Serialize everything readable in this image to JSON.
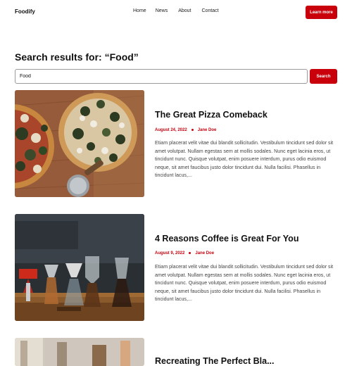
{
  "header": {
    "logo": "Foodify",
    "nav": [
      "Home",
      "News",
      "About",
      "Contact"
    ],
    "cta_label": "Learn more"
  },
  "search": {
    "title": "Search results for: “Food”",
    "value": "Food",
    "button_label": "Search"
  },
  "posts": [
    {
      "title": "The Great Pizza Comeback",
      "date": "August 24, 2022",
      "author": "Jane Doe",
      "excerpt": "Etiam placerat velit vitae dui blandit sollicitudin. Vestibulum tincidunt sed dolor sit amet volutpat. Nullam egestas sem at mollis sodales. Nunc eget lacinia eros, ut tincidunt nunc. Quisque volutpat, enim posuere interdum, purus odio euismod neque, sit amet faucibus justo dolor tincidunt dui. Nulla facilisi. Phasellus in tincidunt lacus,..."
    },
    {
      "title": "4 Reasons Coffee is Great For You",
      "date": "August 9, 2022",
      "author": "Jane Doe",
      "excerpt": "Etiam placerat velit vitae dui blandit sollicitudin. Vestibulum tincidunt sed dolor sit amet volutpat. Nullam egestas sem at mollis sodales. Nunc eget lacinia eros, ut tincidunt nunc. Quisque volutpat, enim posuere interdum, purus odio euismod neque, sit amet faucibus justo dolor tincidunt dui. Nulla facilisi. Phasellus in tincidunt lacus,..."
    },
    {
      "title": "Recreating The Perfect Bla..."
    }
  ],
  "colors": {
    "accent": "#c9000c"
  }
}
